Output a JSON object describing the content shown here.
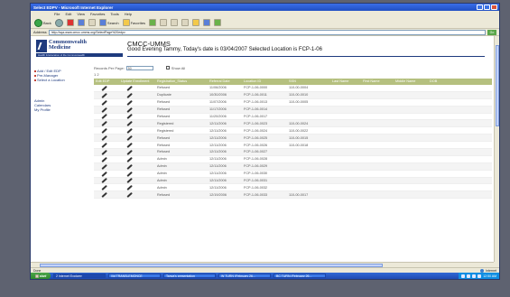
{
  "window": {
    "title": "Select EDPV - Microsoft Internet Explorer"
  },
  "menu": [
    "File",
    "Edit",
    "View",
    "Favorites",
    "Tools",
    "Help"
  ],
  "toolbar": {
    "back": "Back",
    "search": "Search",
    "favorites": "Favorites"
  },
  "address": {
    "label": "Address",
    "value": "http://sqa-www.cmcc.umms.org/SelectPage%20edpv",
    "go": "Go"
  },
  "site": {
    "logo_line1": "Commonwealth",
    "logo_line2": "Medicine",
    "logo_tagline": "Health & Education of the Commonwealth",
    "title": "CMCC-UMMS",
    "greeting": "Good Evening Tammy, Today's date is 03/04/2007 Selected Location is FCP-1-06"
  },
  "sidebar": {
    "links": [
      "Add / Edit EDP",
      "Pre-Manager",
      "Select a Location"
    ],
    "nav": [
      "Admin",
      "Calendars",
      "My Profile"
    ]
  },
  "controls": {
    "records_label": "Records Per Page:",
    "records_value": "50",
    "show_all": "Show All",
    "pager": "1 2"
  },
  "table": {
    "headers": [
      "Edit EDP",
      "Update Enrollment",
      "Registration_Status",
      "Referral Date",
      "Location ID",
      "SSN",
      "Last Name",
      "First Name",
      "Middle Name",
      "DOB"
    ],
    "rows": [
      {
        "status": "Refused",
        "date": "11/06/2006",
        "loc": "FCP-1-06-0000",
        "ssn": "110-00-0004"
      },
      {
        "status": "Duplicate",
        "date": "10/30/2006",
        "loc": "FCP-1-06-0011",
        "ssn": "110-00-0010"
      },
      {
        "status": "Refused",
        "date": "11/07/2006",
        "loc": "FCP-1-06-0013",
        "ssn": "110-00-0005"
      },
      {
        "status": "Refused",
        "date": "11/17/2006",
        "loc": "FCP-1-06-0014",
        "ssn": ""
      },
      {
        "status": "Refused",
        "date": "11/20/2006",
        "loc": "FCP-1-06-0017",
        "ssn": ""
      },
      {
        "status": "Registered",
        "date": "12/11/2006",
        "loc": "FCP-1-06-0023",
        "ssn": "110-00-0024"
      },
      {
        "status": "Registered",
        "date": "12/11/2006",
        "loc": "FCP-1-06-0024",
        "ssn": "110-00-0022"
      },
      {
        "status": "Refused",
        "date": "12/11/2006",
        "loc": "FCP-1-06-0025",
        "ssn": "110-00-0015"
      },
      {
        "status": "Refused",
        "date": "12/11/2006",
        "loc": "FCP-1-06-0026",
        "ssn": "110-00-0018"
      },
      {
        "status": "Refused",
        "date": "12/11/2006",
        "loc": "FCP-1-06-0027",
        "ssn": ""
      },
      {
        "status": "Admin",
        "date": "12/11/2006",
        "loc": "FCP-1-06-0028",
        "ssn": ""
      },
      {
        "status": "Admin",
        "date": "12/11/2006",
        "loc": "FCP-1-06-0029",
        "ssn": ""
      },
      {
        "status": "Admin",
        "date": "12/11/2006",
        "loc": "FCP-1-06-0030",
        "ssn": ""
      },
      {
        "status": "Admin",
        "date": "12/11/2006",
        "loc": "FCP-1-06-0031",
        "ssn": ""
      },
      {
        "status": "Admin",
        "date": "12/11/2006",
        "loc": "FCP-1-06-0032",
        "ssn": ""
      },
      {
        "status": "Refused",
        "date": "12/19/2006",
        "loc": "FCP-1-06-0033",
        "ssn": "110-00-0017"
      }
    ]
  },
  "status": {
    "left": "Done",
    "zone": "Internet"
  },
  "taskbar": {
    "start": "start",
    "tasks": [
      "2 Internet Explorer",
      "\\\\id TRANSLEMONCE",
      "Tanya's presentation",
      "W TURN (February 26...",
      "BC TURN (February 26..."
    ],
    "clock": "12:50 AM"
  },
  "colors": {
    "header_band": "#b5c07f",
    "brand_navy": "#1e3a7e",
    "title_blue": "#1f4fc4"
  }
}
